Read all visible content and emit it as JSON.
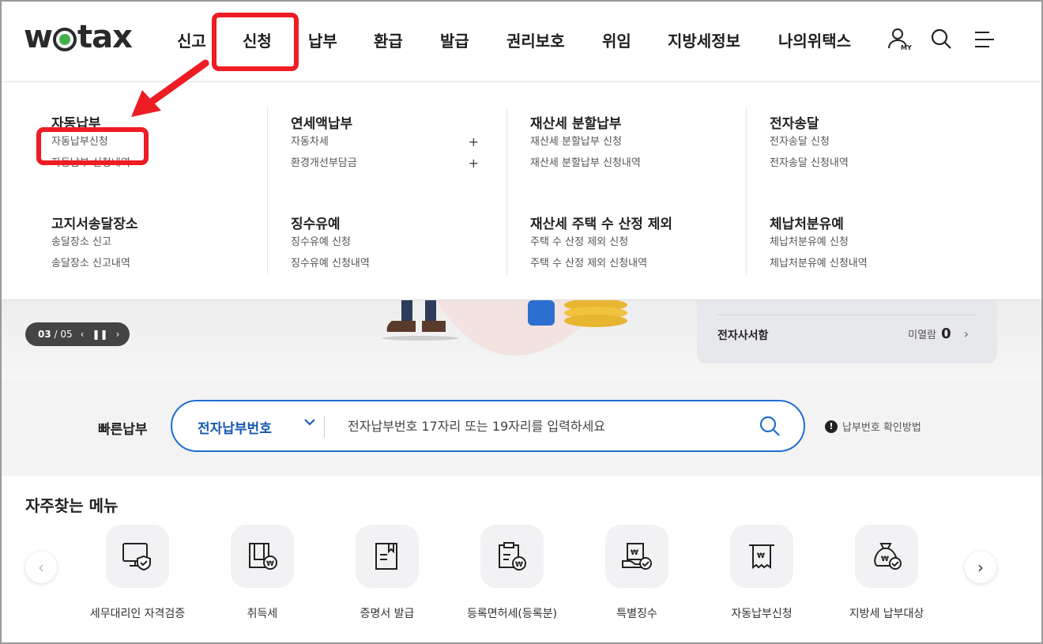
{
  "brand": {
    "logo_left": "w",
    "logo_right": "tax"
  },
  "nav": {
    "items": [
      "신고",
      "신청",
      "납부",
      "환급",
      "발급",
      "권리보호",
      "위임",
      "지방세정보",
      "나의위택스"
    ],
    "my_label": "MY"
  },
  "mega_menu": {
    "groups": [
      {
        "title": "자동납부",
        "items": [
          {
            "label": "자동납부신청"
          },
          {
            "label": "자동납부 신청내역"
          }
        ]
      },
      {
        "title": "연세액납부",
        "items": [
          {
            "label": "자동차세",
            "expandable": "+"
          },
          {
            "label": "환경개선부담금",
            "expandable": "+"
          }
        ]
      },
      {
        "title": "재산세 분할납부",
        "items": [
          {
            "label": "재산세 분할납부 신청"
          },
          {
            "label": "재산세 분할납부 신청내역"
          }
        ]
      },
      {
        "title": "전자송달",
        "items": [
          {
            "label": "전자송달 신청"
          },
          {
            "label": "전자송달 신청내역"
          }
        ]
      },
      {
        "title": "고지서송달장소",
        "items": [
          {
            "label": "송달장소 신고"
          },
          {
            "label": "송달장소 신고내역"
          }
        ]
      },
      {
        "title": "징수유예",
        "items": [
          {
            "label": "징수유예 신청"
          },
          {
            "label": "징수유예 신청내역"
          }
        ]
      },
      {
        "title": "재산세 주택 수 산정 제외",
        "items": [
          {
            "label": "주택 수 산정 제외 신청"
          },
          {
            "label": "주택 수 산정 제외 신청내역"
          }
        ]
      },
      {
        "title": "체납처분유예",
        "items": [
          {
            "label": "체납처분유예 신청"
          },
          {
            "label": "체납처분유예 신청내역"
          }
        ]
      }
    ]
  },
  "hero": {
    "pager": {
      "current": "03",
      "separator": " / ",
      "total": "05"
    },
    "mailbox": {
      "title": "전자사서함",
      "unread_label": "미열람",
      "unread_count": "0"
    }
  },
  "quick_pay": {
    "label": "빠른납부",
    "select_value": "전자납부번호",
    "placeholder": "전자납부번호 17자리 또는 19자리를 입력하세요",
    "help_text": "납부번호 확인방법"
  },
  "frequent": {
    "title": "자주찾는 메뉴",
    "items": [
      {
        "label": "세무대리인 자격검증",
        "icon": "monitor-shield-icon"
      },
      {
        "label": "취득세",
        "icon": "document-won-icon"
      },
      {
        "label": "증명서 발급",
        "icon": "certificate-icon"
      },
      {
        "label": "등록면허세(등록분)",
        "icon": "clipboard-won-icon"
      },
      {
        "label": "특별징수",
        "icon": "hand-won-icon"
      },
      {
        "label": "자동납부신청",
        "icon": "receipt-won-icon"
      },
      {
        "label": "지방세 납부대상",
        "icon": "money-bag-icon"
      }
    ]
  },
  "colors": {
    "accent": "#1d6fd0",
    "highlight": "#ee1c24",
    "logo_green": "#44b04a"
  }
}
